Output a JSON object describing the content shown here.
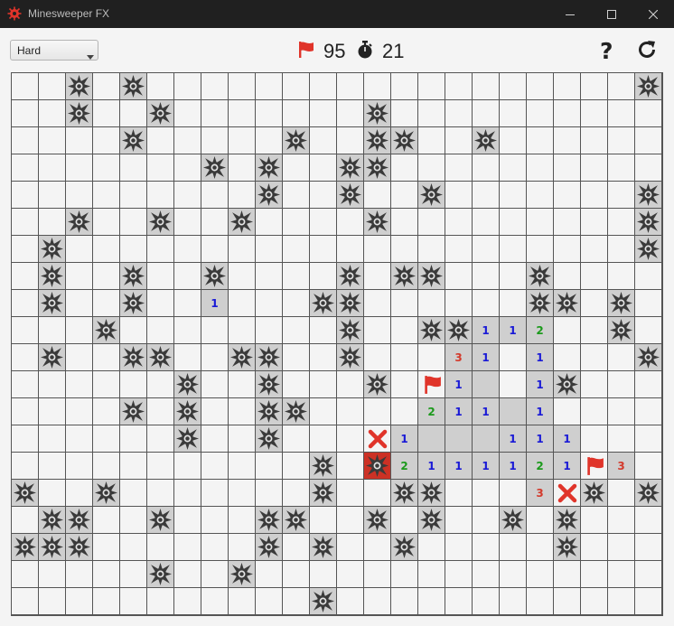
{
  "window": {
    "title": "Minesweeper FX"
  },
  "toolbar": {
    "difficulty": "Hard",
    "flags_remaining": "95",
    "elapsed_seconds": "21",
    "help_label": "?"
  },
  "colors": {
    "flag": "#e0342a",
    "exploded": "#cc3125",
    "wrong_x": "#e0342a",
    "revealed": "#cfcfcf",
    "hidden": "#f4f4f4",
    "number": {
      "1": "#1a1ad6",
      "2": "#1c9a1c",
      "3": "#d33a2c"
    }
  },
  "board": {
    "cols": 24,
    "rows": 20,
    "legend": "m = mine, e = exploded mine, f = flag, x = wrong flag, digits = revealed count, r = revealed empty, . = hidden",
    "grid": [
      "..m.m..................m..",
      "..m..m.......m..........",
      "....m.....m..mm..m......m",
      ".......m.m..mm..........mm",
      ".........m..m..m.......m.",
      "..m..m..m....m.........m",
      ".m.....................m",
      ".m..m..m....m.mm...m....",
      ".m..m..1...mm......mm.m.",
      "...m........m..mm112..m.m",
      ".m..mm..mm..m...31.1...m",
      "......m..m...m.f1r.1m...",
      "....m.m..mm....211r1....",
      "......m..m...x1rrr111...",
      "...........m.e2111121f3.",
      "m..m.......m..mm...3xm.m.",
      ".mm..m...mm..m.m..m.m...",
      "mmm......m.m..m.....m...",
      ".....m..m...............",
      "...........m............"
    ]
  }
}
